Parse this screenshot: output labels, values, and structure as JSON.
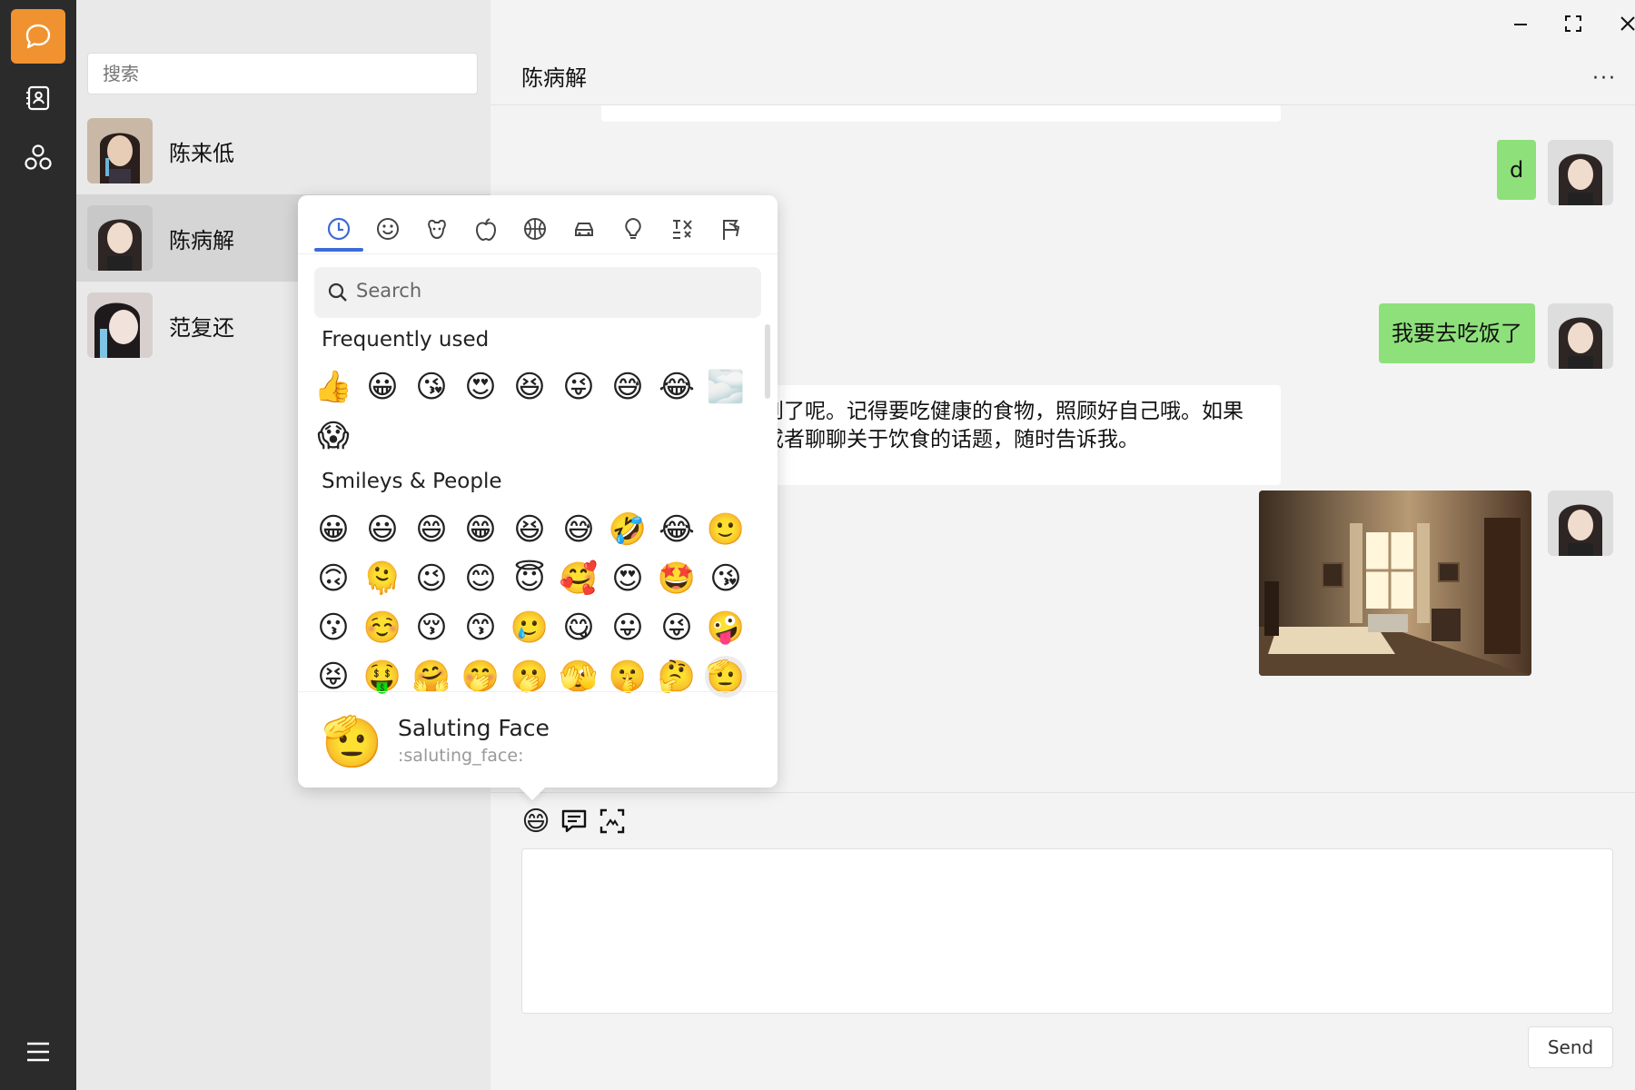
{
  "search": {
    "placeholder": "搜索"
  },
  "contacts": [
    {
      "name": "陈来低"
    },
    {
      "name": "陈病解",
      "selected": true
    },
    {
      "name": "范复还"
    }
  ],
  "chat": {
    "title": "陈病解",
    "more": "···",
    "messages": [
      {
        "from": "me",
        "text": "d"
      },
      {
        "from": "me",
        "text": "我要去吃饭了"
      },
      {
        "from": "other",
        "line1": "到了呢。记得要吃健康的食物，照顾好自己哦。如果",
        "line2": "或者聊聊关于饮食的话题，随时告诉我。"
      },
      {
        "from": "me",
        "type": "image"
      }
    ]
  },
  "composer": {
    "send_label": "Send"
  },
  "emoji_picker": {
    "categories": [
      "recent-icon",
      "smiley-icon",
      "animal-icon",
      "food-icon",
      "activity-icon",
      "travel-icon",
      "objects-icon",
      "symbols-icon",
      "flags-icon"
    ],
    "search_placeholder": "Search",
    "frequently_used_title": "Frequently used",
    "frequently_used": [
      "👍",
      "😀",
      "😘",
      "😍",
      "😆",
      "😜",
      "😅",
      "😂",
      "🌫️",
      "😱"
    ],
    "smileys_title": "Smileys & People",
    "smileys": [
      "😀",
      "😃",
      "😄",
      "😁",
      "😆",
      "😅",
      "🤣",
      "😂",
      "🙂",
      "🙃",
      "🫠",
      "😉",
      "😊",
      "😇",
      "🥰",
      "😍",
      "🤩",
      "😘",
      "😗",
      "☺️",
      "😚",
      "😙",
      "🥲",
      "😋",
      "😛",
      "😜",
      "🤪",
      "😝",
      "🤑",
      "🤗",
      "🤭",
      "🫢",
      "🫣",
      "🤫",
      "🤔",
      "🫡"
    ],
    "preview": {
      "emoji": "🫡",
      "name": "Saluting Face",
      "code": ":saluting_face:"
    }
  },
  "colors": {
    "accent": "#f0922f",
    "bubble_me": "#8ee07b",
    "tab_active": "#3d6bd6"
  }
}
